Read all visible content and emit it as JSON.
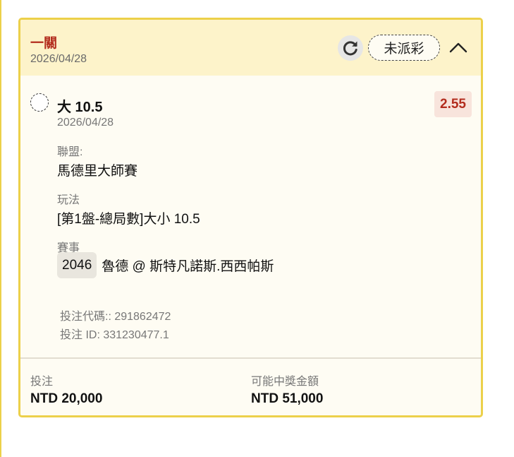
{
  "header": {
    "title": "一關",
    "date": "2026/04/28",
    "status": "未派彩"
  },
  "selection": {
    "name": "大 10.5",
    "date": "2026/04/28",
    "odds": "2.55"
  },
  "details": {
    "league_label": "聯盟:",
    "league_value": "馬德里大師賽",
    "market_label": "玩法",
    "market_value": "[第1盤-總局數]大小 10.5",
    "event_label": "賽事",
    "event_code": "2046",
    "event_teams": "魯德 @ 斯特凡諾斯.西西帕斯"
  },
  "meta": {
    "bet_code": "投注代碼:: 291862472",
    "bet_id": "投注 ID: 331230477.1"
  },
  "footer": {
    "stake_label": "投注",
    "stake_value": "NTD 20,000",
    "payout_label": "可能中獎金額",
    "payout_value": "NTD 51,000"
  },
  "colors": {
    "accent_border": "#ecd04a",
    "header_bg": "#fdf3ca",
    "title_red": "#b32d1e",
    "odds_bg": "#f8e4dc"
  },
  "icons": {
    "refresh": "refresh-icon",
    "collapse": "chevron-up-icon"
  }
}
